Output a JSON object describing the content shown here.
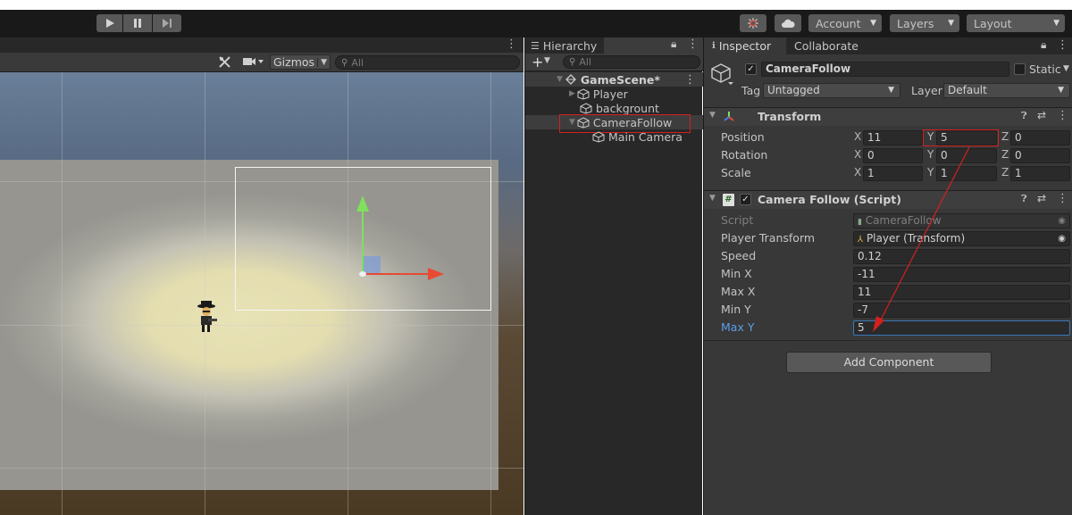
{
  "toolbar": {
    "play_icon": "play-icon",
    "pause_icon": "pause-icon",
    "step_icon": "step-icon",
    "account_label": "Account",
    "layers_label": "Layers",
    "layout_label": "Layout"
  },
  "scene": {
    "gizmos_label": "Gizmos",
    "search_placeholder": "All"
  },
  "hierarchy": {
    "tab_label": "Hierarchy",
    "search_placeholder": "All",
    "scene_name": "GameScene*",
    "items": [
      {
        "label": "Player"
      },
      {
        "label": "backgrount"
      },
      {
        "label": "CameraFollow"
      },
      {
        "label": "Main Camera"
      }
    ]
  },
  "inspector": {
    "tab_label": "Inspector",
    "tab2_label": "Collaborate",
    "object_name": "CameraFollow",
    "static_label": "Static",
    "tag_label": "Tag",
    "tag_value": "Untagged",
    "layer_label": "Layer",
    "layer_value": "Default",
    "transform": {
      "title": "Transform",
      "position_label": "Position",
      "rotation_label": "Rotation",
      "scale_label": "Scale",
      "axis_x": "X",
      "axis_y": "Y",
      "axis_z": "Z",
      "position": {
        "x": "11",
        "y": "5",
        "z": "0"
      },
      "rotation": {
        "x": "0",
        "y": "0",
        "z": "0"
      },
      "scale": {
        "x": "1",
        "y": "1",
        "z": "1"
      }
    },
    "script_component": {
      "title": "Camera Follow (Script)",
      "script_label": "Script",
      "script_value": "CameraFollow",
      "player_transform_label": "Player Transform",
      "player_transform_value": "Player (Transform)",
      "speed_label": "Speed",
      "speed_value": "0.12",
      "min_x_label": "Min X",
      "min_x_value": "-11",
      "max_x_label": "Max X",
      "max_x_value": "11",
      "min_y_label": "Min Y",
      "min_y_value": "-7",
      "max_y_label": "Max Y",
      "max_y_value": "5"
    },
    "add_component_label": "Add Component"
  },
  "colors": {
    "highlight_red": "#d42020",
    "focus_blue": "#3a79bb",
    "selected_row": "#3d3d3d"
  }
}
